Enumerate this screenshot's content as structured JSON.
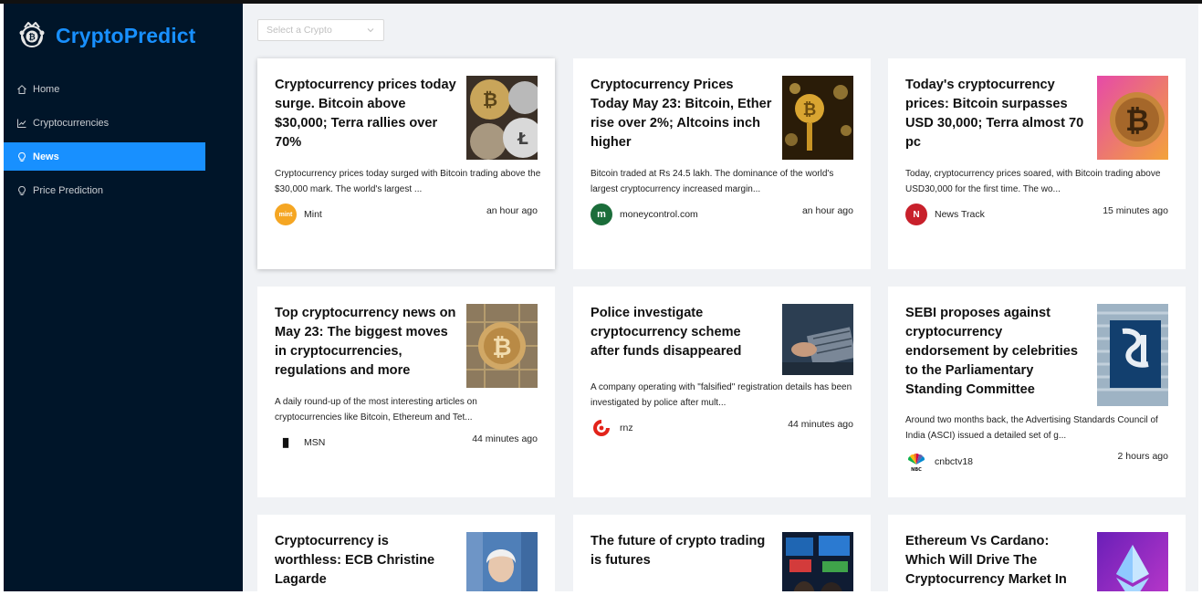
{
  "app": {
    "title": "CryptoPredict"
  },
  "sidebar": {
    "items": [
      {
        "label": "Home",
        "icon": "home-icon",
        "active": false
      },
      {
        "label": "Cryptocurrencies",
        "icon": "line-chart-icon",
        "active": false
      },
      {
        "label": "News",
        "icon": "bulb-icon",
        "active": true
      },
      {
        "label": "Price Prediction",
        "icon": "bulb-icon",
        "active": false
      }
    ]
  },
  "select": {
    "placeholder": "Select a Crypto"
  },
  "colors": {
    "sidebar_bg": "#001529",
    "accent": "#1890ff",
    "content_bg": "#f0f2f5"
  },
  "news": [
    {
      "title": "Cryptocurrency prices today surge. Bitcoin above $30,000; Terra rallies over 70%",
      "description": "Cryptocurrency prices today surged with Bitcoin trading above the $30,000 mark. The world's largest ...",
      "provider": "Mint",
      "time": "an hour ago"
    },
    {
      "title": "Cryptocurrency Prices Today May 23: Bitcoin, Ether rise over 2%; Altcoins inch higher",
      "description": "Bitcoin traded at Rs 24.5 lakh. The dominance of the world's largest cryptocurrency increased margin...",
      "provider": "moneycontrol.com",
      "time": "an hour ago"
    },
    {
      "title": "Today's cryptocurrency prices: Bitcoin surpasses USD 30,000; Terra almost 70 pc",
      "description": "Today, cryptocurrency prices soared, with Bitcoin trading above USD30,000 for the first time. The wo...",
      "provider": "News Track",
      "time": "15 minutes ago"
    },
    {
      "title": "Top cryptocurrency news on May 23: The biggest moves in cryptocurrencies, regulations and more",
      "description": "A daily round-up of the most interesting articles on cryptocurrencies like Bitcoin, Ethereum and Tet...",
      "provider": "MSN",
      "time": "44 minutes ago"
    },
    {
      "title": "Police investigate cryptocurrency scheme after funds disappeared",
      "description": "A company operating with \"falsified\" registration details has been investigated by police after mult...",
      "provider": "rnz",
      "time": "44 minutes ago"
    },
    {
      "title": "SEBI proposes against cryptocurrency endorsement by celebrities to the Parliamentary Standing Committee",
      "description": "Around two months back, the Advertising Standards Council of India (ASCI) issued a detailed set of g...",
      "provider": "cnbctv18",
      "time": "2 hours ago"
    },
    {
      "title": "Cryptocurrency is worthless: ECB Christine Lagarde",
      "description": "",
      "provider": "",
      "time": ""
    },
    {
      "title": "The future of crypto trading is futures",
      "description": "",
      "provider": "",
      "time": ""
    },
    {
      "title": "Ethereum Vs Cardano: Which Will Drive The Cryptocurrency Market In",
      "description": "",
      "provider": "",
      "time": ""
    }
  ]
}
